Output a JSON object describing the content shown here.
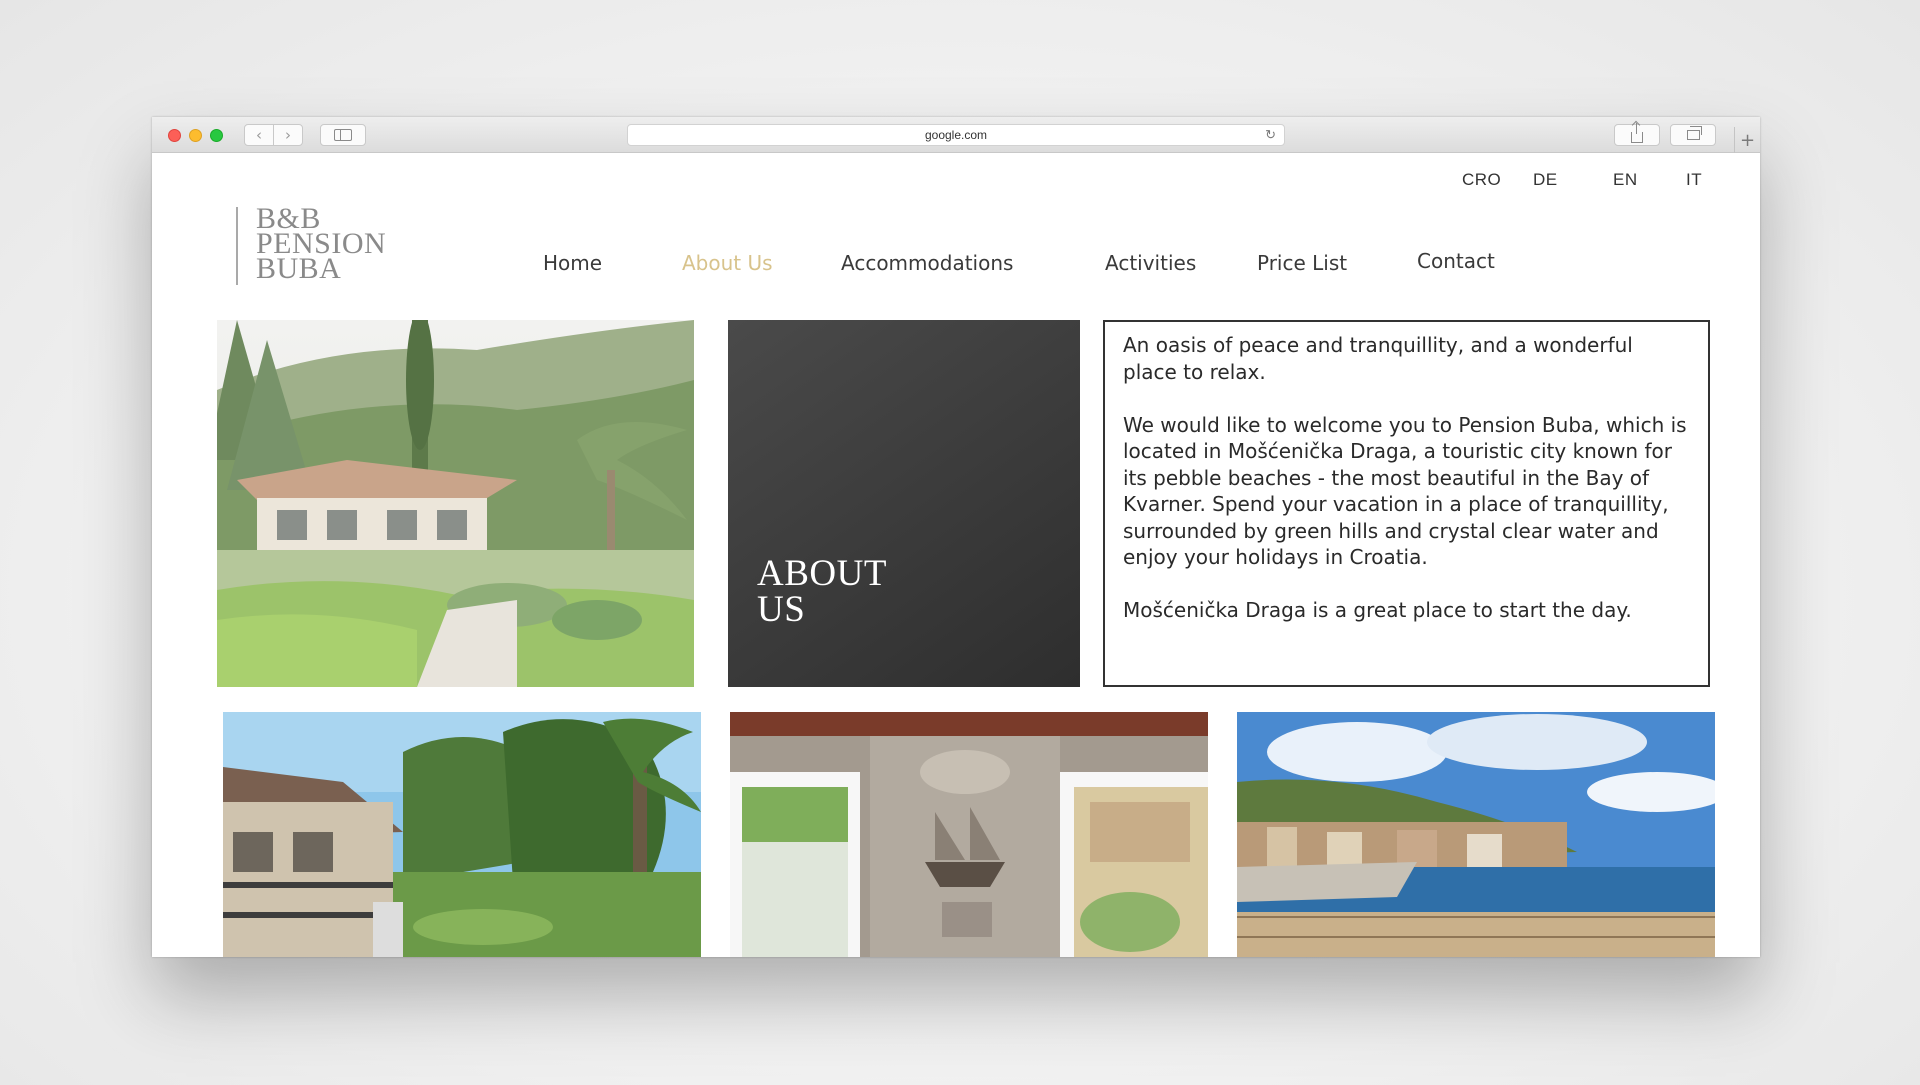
{
  "browser": {
    "url": "google.com"
  },
  "languages": [
    "CRO",
    "DE",
    "EN",
    "IT"
  ],
  "logo": {
    "lines": [
      "B&B",
      "PENSION",
      "BUBA"
    ]
  },
  "nav": {
    "items": [
      "Home",
      "About Us",
      "Accommodations",
      "Activities",
      "Price List",
      "Contact"
    ],
    "active": "About Us"
  },
  "about": {
    "title_line1": "ABOUT",
    "title_line2": "US",
    "intro": "An oasis of peace and tranquillity, and a wonderful place to relax.",
    "body": "We would like to welcome you to Pension Buba, which is located in Mošćenička Draga, a touristic city known for its pebble beaches - the most beautiful in the Bay of Kvarner. Spend your vacation in a place of tranquillity, surrounded by green hills and crystal clear water and enjoy your holidays in Croatia.",
    "closing": "Mošćenička Draga is a great place to start the day."
  },
  "colors": {
    "accent": "#d8c38c",
    "nav_text": "#3a3a3a",
    "tile_dark": "#3a3a3a"
  }
}
